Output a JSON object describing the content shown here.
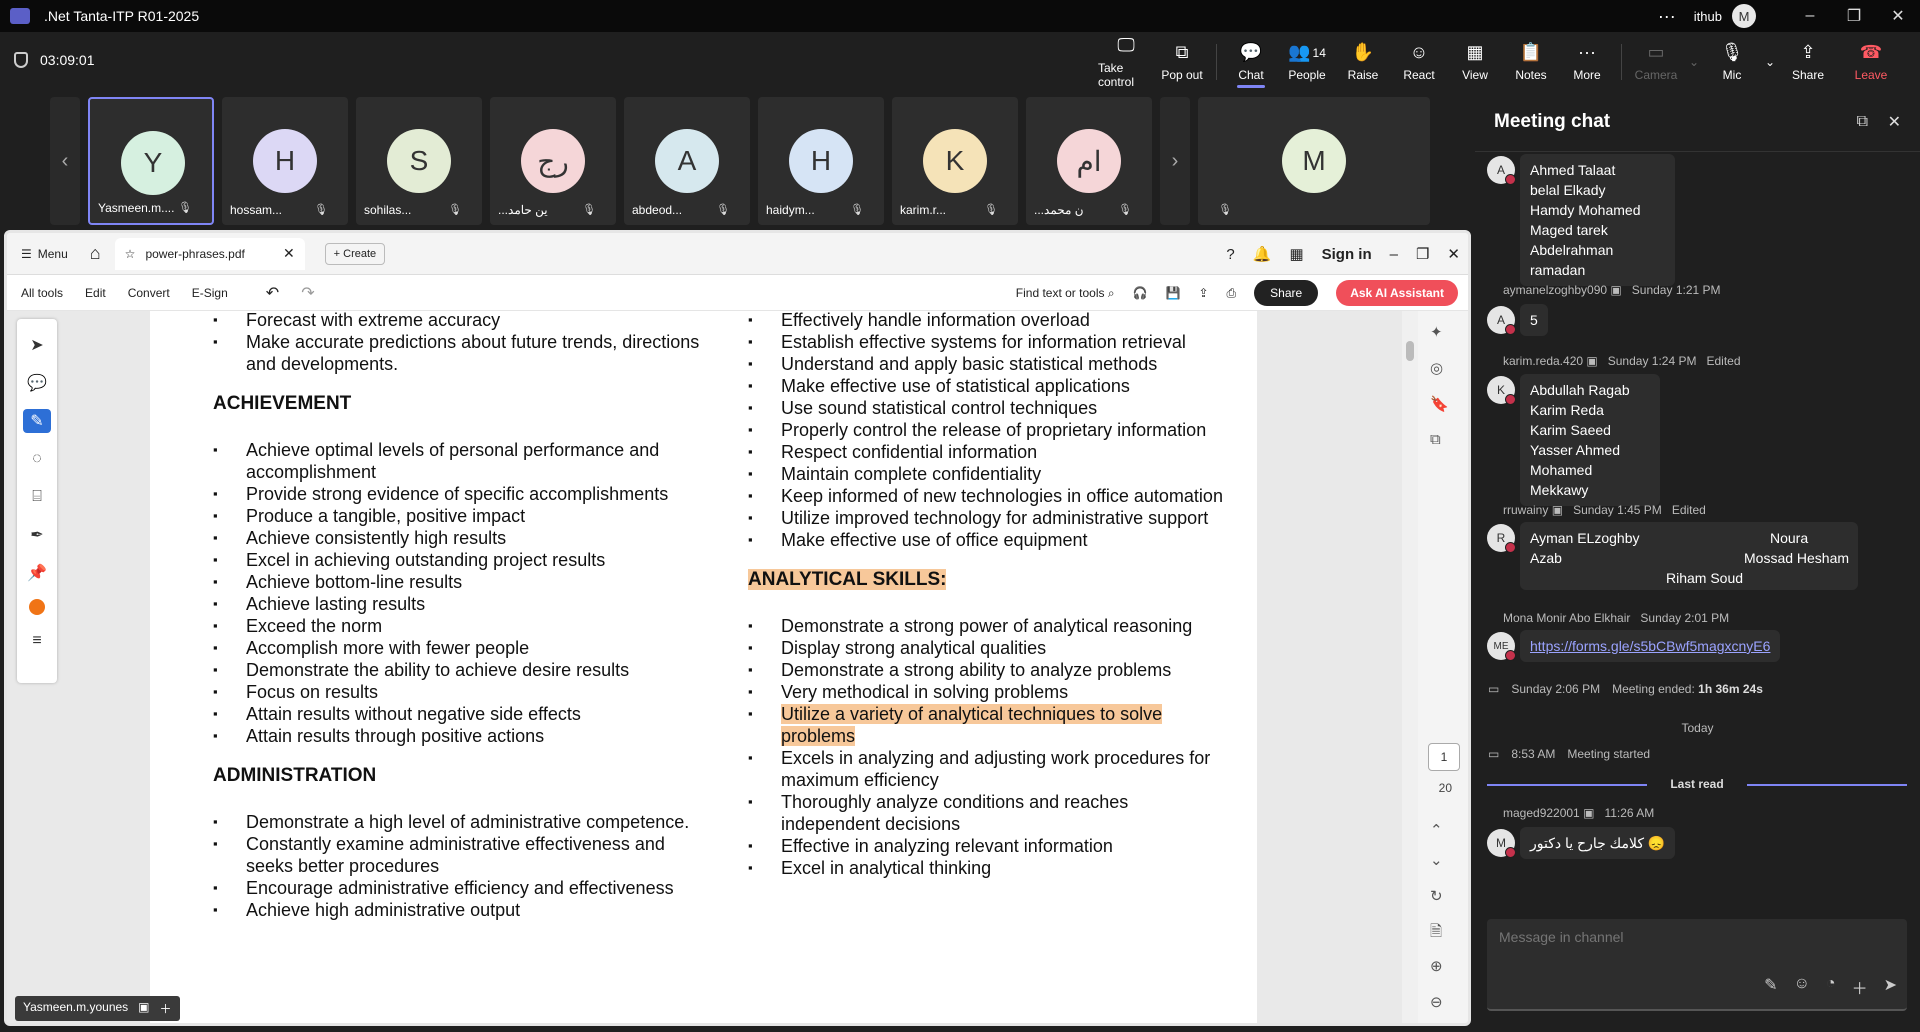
{
  "titlebar": {
    "title": ".Net Tanta-ITP R01-2025",
    "more": "···",
    "user": "ithub",
    "user_initial": "M",
    "minimize": "–",
    "maximize": "❐",
    "close": "✕"
  },
  "meeting": {
    "timer": "03:09:01",
    "toolbar": [
      {
        "label": "Take control",
        "icon": "🖵"
      },
      {
        "label": "Pop out",
        "icon": "⧉"
      },
      {
        "label": "Chat",
        "icon": "💬"
      },
      {
        "label": "People",
        "icon": "👥",
        "count": "14"
      },
      {
        "label": "Raise",
        "icon": "✋"
      },
      {
        "label": "React",
        "icon": "☺"
      },
      {
        "label": "View",
        "icon": "▦"
      },
      {
        "label": "Notes",
        "icon": "📋"
      },
      {
        "label": "More",
        "icon": "···"
      }
    ],
    "camera": "Camera",
    "mic": "Mic",
    "share": "Share",
    "leave": "Leave"
  },
  "participants": [
    {
      "initial": "Y",
      "name": "Yasmeen.m....",
      "color": "#d6f0e0"
    },
    {
      "initial": "H",
      "name": "hossam...",
      "color": "#dcd8f5"
    },
    {
      "initial": "S",
      "name": "sohilas...",
      "color": "#e3ecd5"
    },
    {
      "initial": "رج",
      "name": "...ين حامد",
      "color": "#f5d6d8"
    },
    {
      "initial": "A",
      "name": "abdeod...",
      "color": "#d6e8ee"
    },
    {
      "initial": "H",
      "name": "haidym...",
      "color": "#d6e4f5"
    },
    {
      "initial": "K",
      "name": "karim.r...",
      "color": "#f5e3b8"
    },
    {
      "initial": "ام",
      "name": "...ن محمد",
      "color": "#f5d6d8"
    }
  ],
  "big_tile_initial": "M",
  "acrobat": {
    "menu": "Menu",
    "tab_title": "power-phrases.pdf",
    "create": "Create",
    "sign_in": "Sign in",
    "tools": [
      "All tools",
      "Edit",
      "Convert",
      "E-Sign"
    ],
    "find": "Find text or tools",
    "share": "Share",
    "ai": "Ask AI Assistant",
    "page_current": "1",
    "page_total": "20",
    "sharer": "Yasmeen.m.younes"
  },
  "pdf": {
    "col1_top": [
      "Forecast with extreme accuracy",
      "Make accurate predictions about future trends, directions and developments."
    ],
    "achievement_heading": "ACHIEVEMENT",
    "achievement": [
      "Achieve optimal levels of personal performance and accomplishment",
      "Provide strong evidence of specific accomplishments",
      "Produce a tangible, positive impact",
      "Achieve consistently high results",
      "Excel in achieving outstanding project results",
      "Achieve bottom-line results",
      "Achieve lasting results",
      "Exceed the norm",
      "Accomplish more with fewer people",
      "Demonstrate the ability to achieve desire results",
      "Focus on results",
      "Attain results without negative side effects",
      "Attain results through positive actions"
    ],
    "administration_heading": "ADMINISTRATION",
    "administration": [
      "Demonstrate a high level of administrative competence.",
      "Constantly examine administrative effectiveness and seeks better procedures",
      "Encourage administrative efficiency and effectiveness",
      "Achieve high administrative output"
    ],
    "col2_top": [
      "Effectively handle information overload",
      "Establish effective systems for information retrieval",
      "Understand and apply basic statistical methods",
      "Make effective use of statistical applications",
      "Use sound statistical control techniques",
      "Properly control the release of proprietary information",
      "Respect confidential information",
      "Maintain complete confidentiality",
      "Keep informed of new technologies in office automation",
      "Utilize improved technology for administrative support",
      "Make effective use of office equipment"
    ],
    "analytical_heading": "ANALYTICAL SKILLS:",
    "analytical": [
      "Demonstrate a strong power of analytical reasoning",
      "Display strong analytical qualities",
      "Demonstrate a strong ability to analyze problems",
      "Very methodical in solving problems",
      "Utilize a variety of analytical techniques to solve problems",
      "Excels in analyzing and adjusting work procedures for maximum efficiency",
      "Thoroughly analyze conditions and reaches independent decisions",
      "Effective in analyzing relevant information",
      "Excel in analytical thinking"
    ]
  },
  "chat": {
    "title": "Meeting chat",
    "msg1_lines": [
      "Ahmed Talaat",
      "belal Elkady",
      "Hamdy Mohamed",
      "Maged tarek",
      "Abdelrahman ramadan"
    ],
    "msg1_initial": "A",
    "msg2_sender": "aymanelzoghby090",
    "msg2_time": "Sunday 1:21 PM",
    "msg2_text": "5",
    "msg2_initial": "A",
    "msg3_sender": "karim.reda.420",
    "msg3_time": "Sunday 1:24 PM",
    "msg3_edited": "Edited",
    "msg3_initial": "K",
    "msg3_lines": [
      "Abdullah Ragab",
      "Karim Reda",
      "Karim Saeed",
      "Yasser Ahmed",
      "Mohamed Mekkawy"
    ],
    "msg4_sender": "rruwainy",
    "msg4_time": "Sunday 1:45 PM",
    "msg4_edited": "Edited",
    "msg4_initial": "R",
    "msg4_a": "Ayman  ELzoghby",
    "msg4_b": "Noura",
    "msg4_c": "Azab",
    "msg4_d": "Mossad Hesham",
    "msg4_e": "Riham Soud",
    "msg5_sender": "Mona Monir Abo Elkhair",
    "msg5_time": "Sunday 2:01 PM",
    "msg5_initial": "ME",
    "msg5_link": "https://forms.gle/s5bCBwf5magxcnyE6",
    "ended_time": "Sunday 2:06 PM",
    "ended_text": "Meeting ended:",
    "ended_dur": "1h 36m 24s",
    "today": "Today",
    "started_time": "8:53 AM",
    "started_text": "Meeting started",
    "last_read": "Last read",
    "msg6_sender": "maged922001",
    "msg6_time": "11:26 AM",
    "msg6_text": "😞 كلامك جارح يا دكتور",
    "msg6_initial": "M",
    "compose_placeholder": "Message in channel"
  }
}
